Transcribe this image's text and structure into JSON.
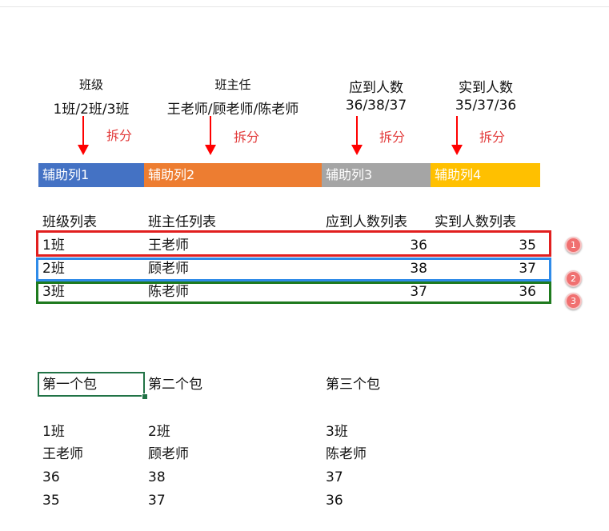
{
  "columns": [
    {
      "header": "班级",
      "value": "1班/2班/3班",
      "split": "拆分"
    },
    {
      "header": "班主任",
      "value": "王老师/顾老师/陈老师",
      "split": "拆分"
    },
    {
      "header": "应到人数",
      "value": "36/38/37",
      "split": "拆分"
    },
    {
      "header": "实到人数",
      "value": "35/37/36",
      "split": "拆分"
    }
  ],
  "helper_columns": [
    {
      "label": "辅助列1",
      "color": "#4472c4"
    },
    {
      "label": "辅助列2",
      "color": "#ed7d31"
    },
    {
      "label": "辅助列3",
      "color": "#a5a5a5"
    },
    {
      "label": "辅助列4",
      "color": "#ffc000"
    }
  ],
  "list_table": {
    "headers": [
      "班级列表",
      "班主任列表",
      "应到人数列表",
      "实到人数列表"
    ],
    "rows": [
      {
        "cls": "1班",
        "teacher": "王老师",
        "expected": "36",
        "actual": "35",
        "badge": "1",
        "box_color": "#e11f1f"
      },
      {
        "cls": "2班",
        "teacher": "顾老师",
        "expected": "38",
        "actual": "37",
        "badge": "2",
        "box_color": "#2f8be8"
      },
      {
        "cls": "3班",
        "teacher": "陈老师",
        "expected": "37",
        "actual": "36",
        "badge": "3",
        "box_color": "#1e7a1e"
      }
    ]
  },
  "packages": [
    {
      "title": "第一个包",
      "items": [
        "1班",
        "王老师",
        "36",
        "35"
      ]
    },
    {
      "title": "第二个包",
      "items": [
        "2班",
        "顾老师",
        "38",
        "37"
      ]
    },
    {
      "title": "第三个包",
      "items": [
        "3班",
        "陈老师",
        "37",
        "36"
      ]
    }
  ]
}
